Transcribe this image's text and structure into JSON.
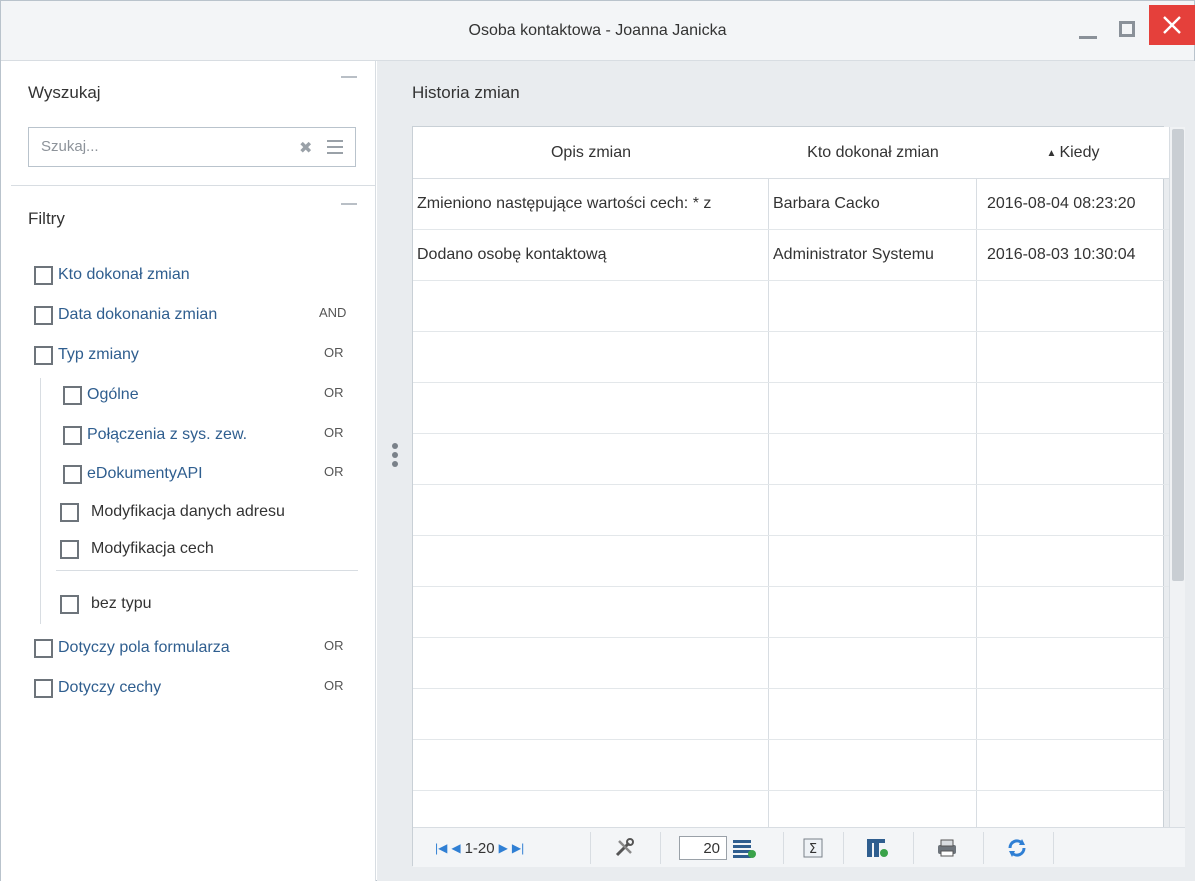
{
  "window": {
    "title": "Osoba kontaktowa - Joanna Janicka"
  },
  "left": {
    "search": {
      "title": "Wyszukaj",
      "placeholder": "Szukaj..."
    },
    "filters": {
      "title": "Filtry",
      "items": [
        {
          "label": "Kto dokonał zmian",
          "op": ""
        },
        {
          "label": "Data dokonania zmian",
          "op": "AND"
        },
        {
          "label": "Typ zmiany",
          "op": "OR"
        },
        {
          "label": "Ogólne",
          "op": "OR"
        },
        {
          "label": "Połączenia z sys. zew.",
          "op": "OR"
        },
        {
          "label": "eDokumentyAPI",
          "op": "OR"
        },
        {
          "label": "Modyfikacja danych adresu",
          "op": ""
        },
        {
          "label": "Modyfikacja cech",
          "op": ""
        },
        {
          "label": "bez typu",
          "op": ""
        },
        {
          "label": "Dotyczy pola formularza",
          "op": "OR"
        },
        {
          "label": "Dotyczy cechy",
          "op": "OR"
        }
      ]
    }
  },
  "grid": {
    "title": "Historia zmian",
    "columns": [
      "Opis zmian",
      "Kto dokonał zmian",
      "Kiedy"
    ],
    "sort_indicator": "▲",
    "rows": [
      [
        "Zmieniono następujące wartości cech: * z",
        "Barbara Cacko",
        "2016-08-04 08:23:20"
      ],
      [
        "Dodano osobę kontaktową",
        "Administrator Systemu",
        "2016-08-03 10:30:04"
      ]
    ],
    "pager": {
      "range": "1-20",
      "page_size": "20"
    }
  },
  "colors": {
    "accent": "#2f7fd4",
    "link": "#2f5e8f",
    "close": "#e5403b"
  }
}
